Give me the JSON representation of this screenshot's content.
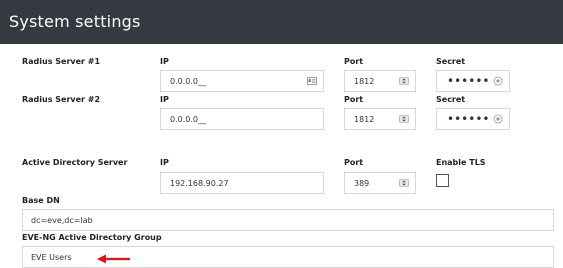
{
  "window": {
    "title": "System settings"
  },
  "radius1": {
    "label": "Radius Server #1",
    "ip_label": "IP",
    "ip_value": "0.0.0.0__",
    "port_label": "Port",
    "port_value": "1812",
    "secret_label": "Secret",
    "secret_value": "••••••"
  },
  "radius2": {
    "label": "Radius Server #2",
    "ip_label": "IP",
    "ip_value": "0.0.0.0__",
    "port_label": "Port",
    "port_value": "1812",
    "secret_label": "Secret",
    "secret_value": "••••••"
  },
  "ad": {
    "label": "Active Directory Server",
    "ip_label": "IP",
    "ip_value": "192.168.90.27",
    "port_label": "Port",
    "port_value": "389",
    "tls_label": "Enable TLS",
    "tls_checked": false
  },
  "base_dn": {
    "label": "Base DN",
    "value": "dc=eve,dc=lab"
  },
  "ad_group": {
    "label": "EVE-NG Active Directory Group",
    "value": "EVE Users"
  },
  "icons": {
    "ip_helper": "id-card-icon",
    "port_stepper": "spinner-arrows-icon",
    "secret_reveal": "eye-icon",
    "annotation": "red-arrow-icon"
  },
  "colors": {
    "titlebar": "#343a40",
    "annotation": "#e0141a"
  }
}
